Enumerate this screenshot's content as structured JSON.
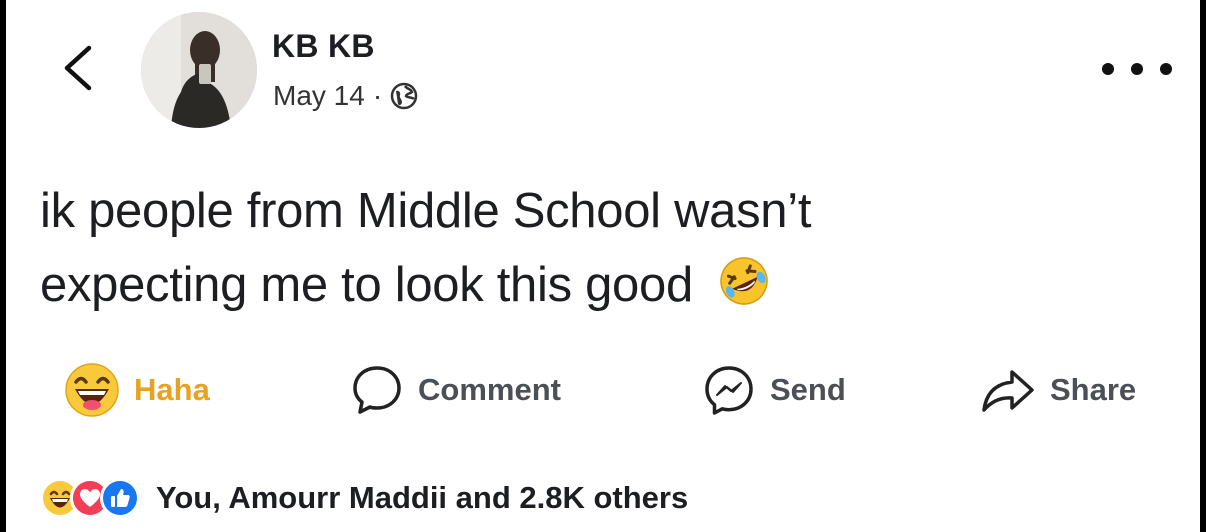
{
  "post": {
    "author_name": "KB KB",
    "date": "May 14",
    "separator": "·",
    "text_line1": "ik people from Middle School wasn’t",
    "text_line2": "expecting me to look this good"
  },
  "actions": {
    "reaction_label": "Haha",
    "comment_label": "Comment",
    "send_label": "Send",
    "share_label": "Share"
  },
  "reactions": {
    "summary": "You, Amourr Maddii and 2.8K others"
  },
  "icons": {
    "back": "chevron-left-icon",
    "privacy": "globe-icon",
    "more": "more-options-icon",
    "haha": "haha-emoji-icon",
    "comment": "comment-bubble-icon",
    "send": "messenger-icon",
    "share": "share-arrow-icon",
    "love": "heart-reaction-icon",
    "like": "like-reaction-icon"
  },
  "colors": {
    "haha": "#e8a221",
    "like": "#1877f2",
    "love": "#f33e58"
  }
}
